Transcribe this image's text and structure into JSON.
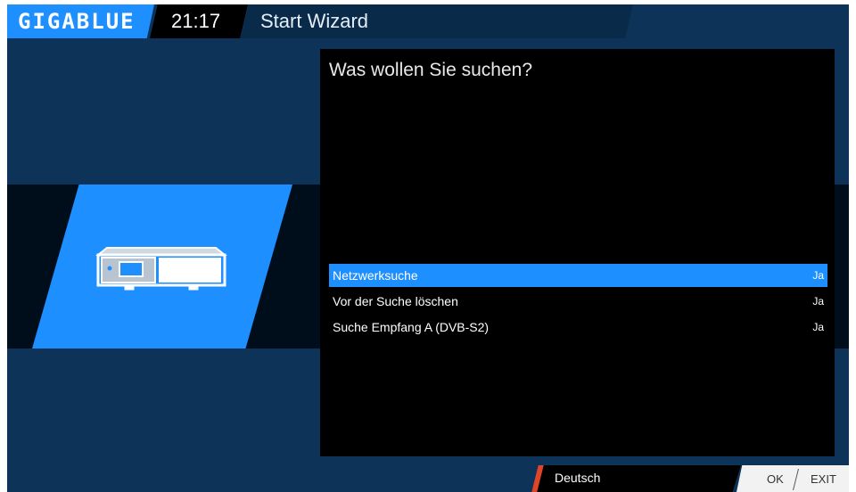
{
  "brand": {
    "logo": "GIGABLUE"
  },
  "header": {
    "time": "21:17",
    "title": "Start Wizard"
  },
  "wizard": {
    "question": "Was wollen Sie suchen?",
    "options": [
      {
        "label": "Netzwerksuche",
        "value": "Ja",
        "selected": true
      },
      {
        "label": "Vor der Suche löschen",
        "value": "Ja",
        "selected": false
      },
      {
        "label": "Suche Empfang A (DVB-S2)",
        "value": "Ja",
        "selected": false
      }
    ]
  },
  "footer": {
    "language": "Deutsch",
    "ok": "OK",
    "exit": "EXIT"
  },
  "icons": {
    "device": "receiver-icon"
  },
  "colors": {
    "accent": "#1e8fff",
    "background": "#0d3358",
    "panel": "#000000",
    "red_key": "#e0452a"
  }
}
